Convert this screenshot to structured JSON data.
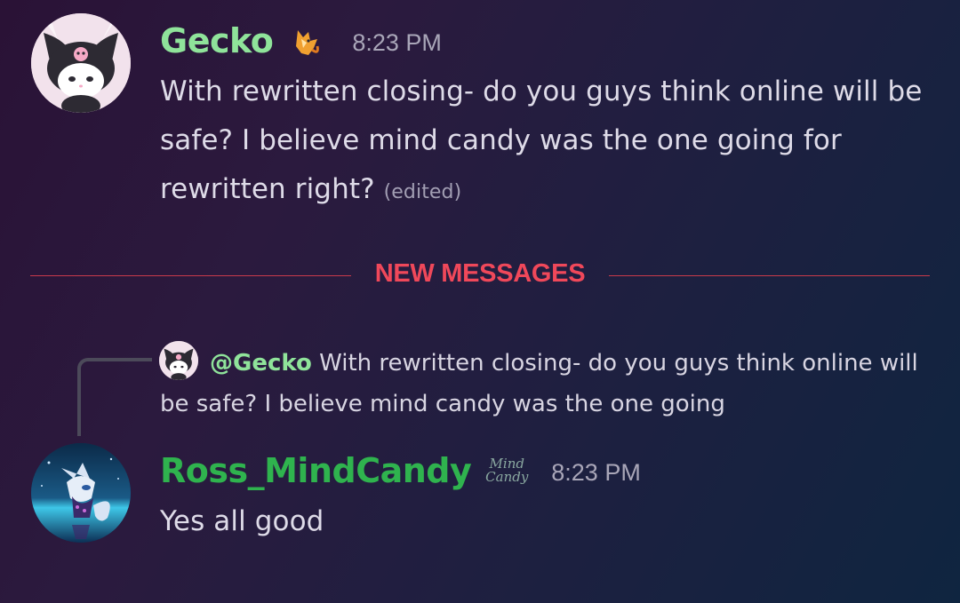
{
  "messages": [
    {
      "username": "Gecko",
      "username_color": "#8fe39a",
      "badge_icon": "fox-emoji-badge",
      "timestamp": "8:23 PM",
      "text": "With rewritten closing- do you  guys think online will be safe? I believe mind candy was the one going for rewritten right?",
      "edited_label": "(edited)",
      "avatar_icon": "kuromi-avatar"
    },
    {
      "username": "Ross_MindCandy",
      "username_color": "#2fb34e",
      "badge_text": "Mind Candy",
      "timestamp": "8:23 PM",
      "text": "Yes all good",
      "avatar_icon": "fox-character-avatar"
    }
  ],
  "divider": {
    "label": "NEW MESSAGES",
    "color": "#f0485a"
  },
  "reply": {
    "mention": "@Gecko",
    "text": "With rewritten closing- do you  guys think online will be safe? I believe mind candy was the one going"
  }
}
